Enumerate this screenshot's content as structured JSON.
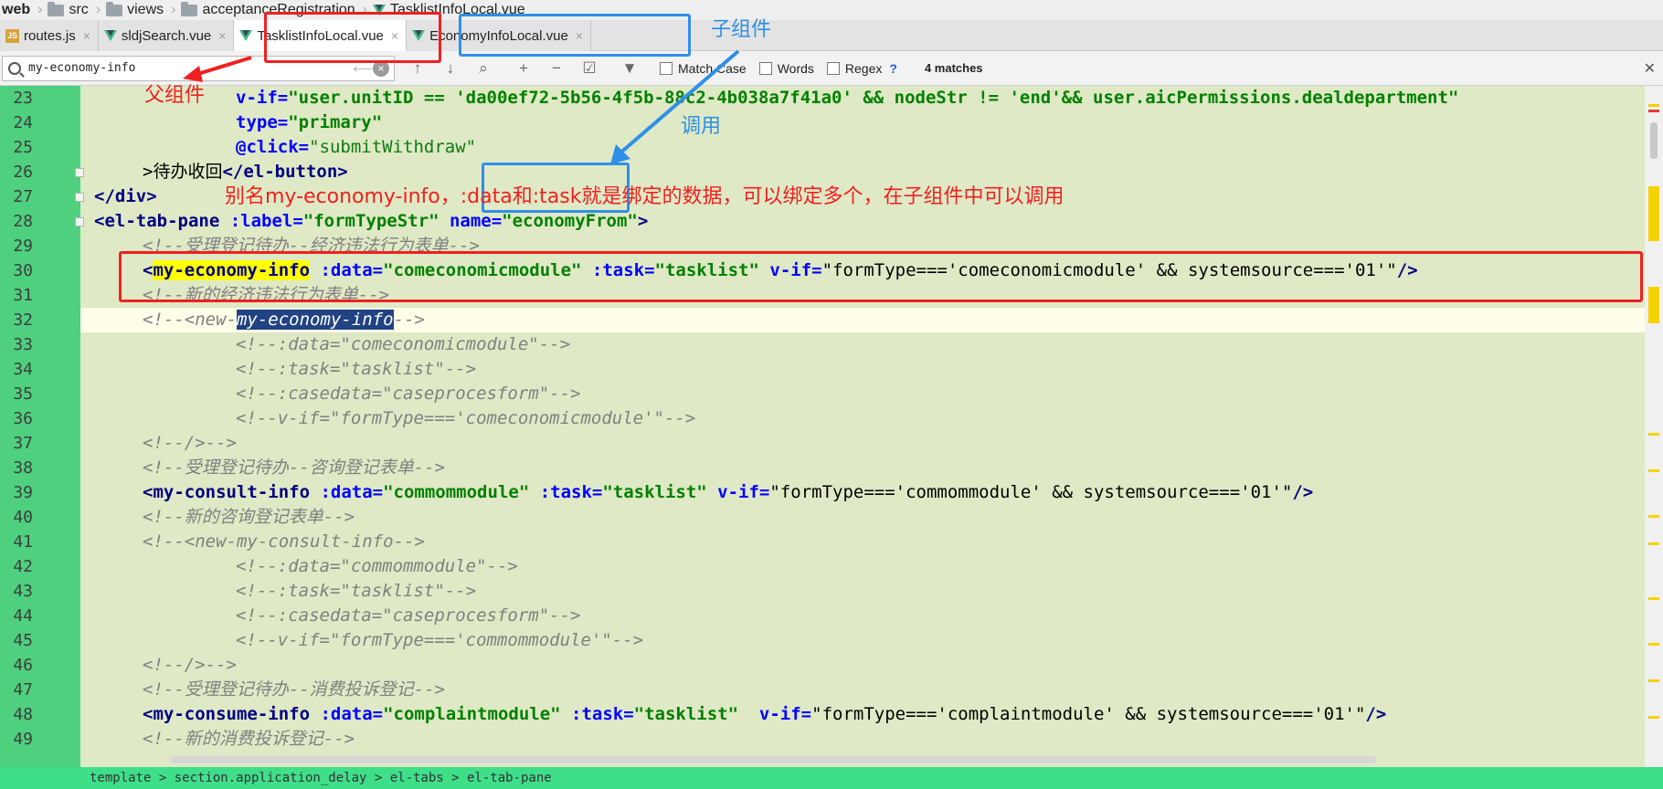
{
  "breadcrumb": {
    "items": [
      "web",
      "src",
      "views",
      "acceptanceRegistration",
      "TasklistInfoLocal.vue"
    ]
  },
  "tabs": [
    {
      "label": "routes.js",
      "icon": "js-file-icon"
    },
    {
      "label": "sldjSearch.vue",
      "icon": "vue-file-icon"
    },
    {
      "label": "TasklistInfoLocal.vue",
      "icon": "vue-file-icon",
      "active": true
    },
    {
      "label": "EconomyInfoLocal.vue",
      "icon": "vue-file-icon"
    }
  ],
  "find": {
    "query": "my-economy-info",
    "match_case": "Match Case",
    "words": "Words",
    "regex": "Regex",
    "help": "?",
    "matches": "4 matches"
  },
  "editor": {
    "line_numbers": [
      "23",
      "24",
      "25",
      "26",
      "27",
      "28",
      "29",
      "30",
      "31",
      "32",
      "33",
      "34",
      "35",
      "36",
      "37",
      "38",
      "39",
      "40",
      "41",
      "42",
      "43",
      "44",
      "45",
      "46",
      "47",
      "48",
      "49"
    ],
    "code": {
      "l23": {
        "attr": "v-if=",
        "s1": "\"user.unitID == 'da00ef72-5b56-4f5b-88c2-4b038a7f41a0' && nodeStr != 'end'&& user.aicPermissions.dealdepartment\""
      },
      "l24": {
        "attr": "type=",
        "s1": "\"primary\""
      },
      "l25": {
        "attr": "@click=",
        "s1": "\"submitWithdraw\""
      },
      "l26": {
        "text": ">待办收回",
        "close": "</el-button>"
      },
      "l27": {
        "tag": "</div>"
      },
      "l28": {
        "tag": "<el-tab-pane",
        "a1": " :label=",
        "s1": "\"formTypeStr\"",
        "a2": " name=",
        "s2": "\"economyFrom\"",
        "end": ">"
      },
      "l29": {
        "comment": "<!--受理登记待办--经济违法行为表单-->"
      },
      "l30": {
        "lt": "<",
        "tag": "my-economy-info",
        "a1": " :data=",
        "s1": "\"comeconomicmodule\"",
        "a2": " :task=",
        "s2": "\"tasklist\"",
        "a3": " v-if=",
        "s3": "\"formType==='comeconomicmodule' && systemsource==='01'\"",
        "end": "/>"
      },
      "l31": {
        "comment": "<!--新的经济违法行为表单-->"
      },
      "l32": {
        "pre": "<!--<new-",
        "sel": "my-economy-info",
        "post": "-->"
      },
      "l33": {
        "comment": "<!--:data=\"comeconomicmodule\"-->"
      },
      "l34": {
        "comment": "<!--:task=\"tasklist\"-->"
      },
      "l35": {
        "comment": "<!--:casedata=\"caseprocesform\"-->"
      },
      "l36": {
        "comment": "<!--v-if=\"formType==='comeconomicmodule'\"-->"
      },
      "l37": {
        "comment": "<!--/>-->"
      },
      "l38": {
        "comment": "<!--受理登记待办--咨询登记表单-->"
      },
      "l39": {
        "tag": "<my-consult-info",
        "a1": " :data=",
        "s1": "\"commommodule\"",
        "a2": " :task=",
        "s2": "\"tasklist\"",
        "a3": " v-if=",
        "s3": "\"formType==='commommodule' && systemsource==='01'\"",
        "end": "/>"
      },
      "l40": {
        "comment": "<!--新的咨询登记表单-->"
      },
      "l41": {
        "comment": "<!--<new-my-consult-info-->"
      },
      "l42": {
        "comment": "<!--:data=\"commommodule\"-->"
      },
      "l43": {
        "comment": "<!--:task=\"tasklist\"-->"
      },
      "l44": {
        "comment": "<!--:casedata=\"caseprocesform\"-->"
      },
      "l45": {
        "comment": "<!--v-if=\"formType==='commommodule'\"-->"
      },
      "l46": {
        "comment": "<!--/>-->"
      },
      "l47": {
        "comment": "<!--受理登记待办--消费投诉登记-->"
      },
      "l48": {
        "tag": "<my-consume-info",
        "a1": " :data=",
        "s1": "\"complaintmodule\"",
        "a2": " :task=",
        "s2": "\"tasklist\"",
        "a3": "  v-if=",
        "s3": "\"formType==='complaintmodule' && systemsource==='01'\"",
        "end": "/>"
      },
      "l49": {
        "comment": "<!--新的消费投诉登记-->"
      }
    }
  },
  "statusbar": {
    "path": "template > section.application_delay > el-tabs > el-tab-pane"
  },
  "annotations": {
    "parent": "父组件",
    "child": "子组件",
    "call": "调用",
    "note": "别名my-economy-info，:data和:task就是绑定的数据，可以绑定多个，在子组件中可以调用"
  },
  "colors": {
    "gutter": "#4fd07f",
    "code_bg": "#dfe9c5",
    "annotation_red": "#f02020",
    "annotation_blue": "#2f8fe8",
    "match_highlight": "#ffff00"
  }
}
